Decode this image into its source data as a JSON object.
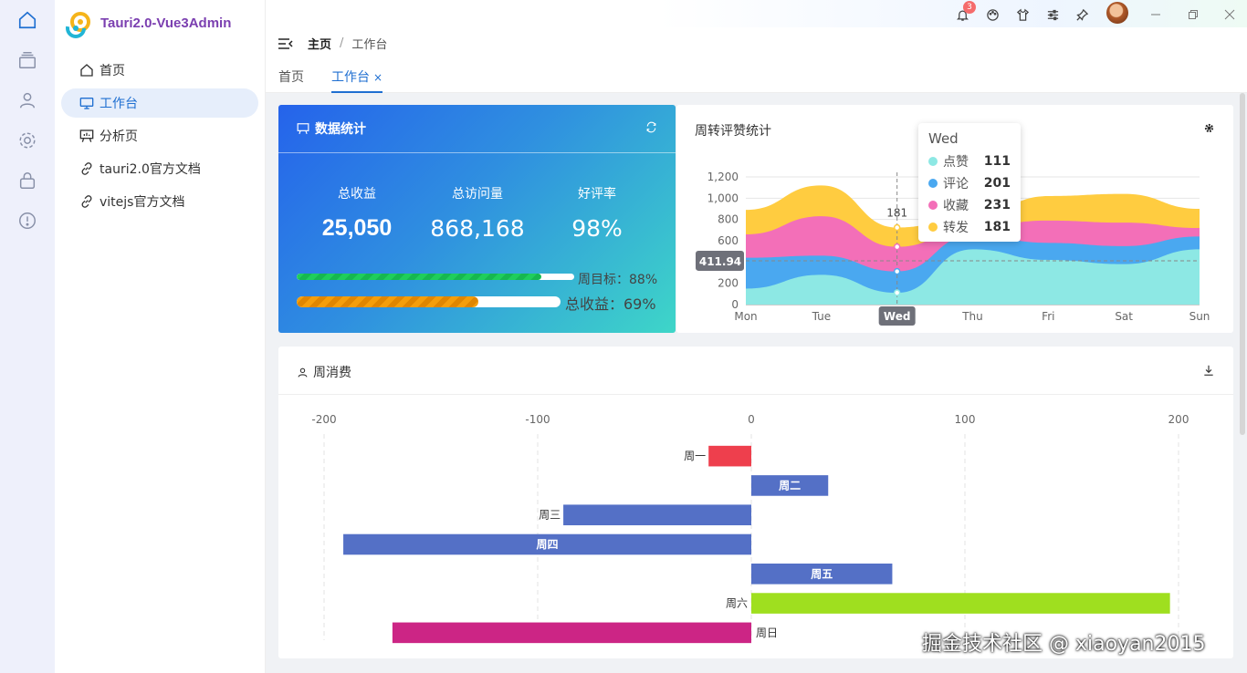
{
  "app": {
    "title": "Tauri2.0-Vue3Admin"
  },
  "rail": {
    "icons": [
      "home-icon",
      "layers-icon",
      "user-icon",
      "settings-icon",
      "lock-icon",
      "alert-icon"
    ]
  },
  "sidebar": {
    "items": [
      {
        "label": "首页",
        "icon": "home-icon",
        "active": false
      },
      {
        "label": "工作台",
        "icon": "monitor-icon",
        "active": true
      },
      {
        "label": "分析页",
        "icon": "chart-board-icon",
        "active": false
      },
      {
        "label": "tauri2.0官方文档",
        "icon": "link-icon",
        "active": false
      },
      {
        "label": "vitejs官方文档",
        "icon": "link-icon",
        "active": false
      }
    ]
  },
  "topbar": {
    "notification_count": "3",
    "icons": [
      "bell-icon",
      "palette-icon",
      "shirt-icon",
      "sliders-icon",
      "pin-icon",
      "avatar",
      "minimize-icon",
      "restore-icon",
      "close-icon"
    ]
  },
  "breadcrumb": {
    "root": "主页",
    "sep": "/",
    "current": "工作台"
  },
  "tabs": [
    {
      "label": "首页",
      "active": false
    },
    {
      "label": "工作台",
      "active": true,
      "close": "×"
    }
  ],
  "stats": {
    "title": "数据统计",
    "kpis": [
      {
        "label": "总收益",
        "value": "25,050"
      },
      {
        "label": "总访问量",
        "value": "868,168"
      },
      {
        "label": "好评率",
        "value": "98%"
      }
    ],
    "progress": [
      {
        "label": "周目标：88%",
        "value": 0.88,
        "color": "#22c55e"
      },
      {
        "label": "总收益：69%",
        "value": 0.69,
        "color": "#f59e0b"
      }
    ]
  },
  "chart_data": [
    {
      "type": "area",
      "title": "周转评赞统计",
      "stacked": true,
      "categories": [
        "Mon",
        "Tue",
        "Wed",
        "Thu",
        "Fri",
        "Sat",
        "Sun"
      ],
      "ylim": [
        0,
        1200
      ],
      "yticks": [
        "0",
        "200",
        "400",
        "600",
        "800",
        "1,000",
        "1,200"
      ],
      "series": [
        {
          "name": "点赞",
          "color": "#8de8e4",
          "values": [
            150,
            280,
            111,
            520,
            420,
            380,
            520
          ]
        },
        {
          "name": "评论",
          "color": "#4aa8f0",
          "values": [
            290,
            180,
            201,
            130,
            160,
            170,
            120
          ]
        },
        {
          "name": "收藏",
          "color": "#f36fb8",
          "values": [
            220,
            370,
            231,
            80,
            210,
            220,
            80
          ]
        },
        {
          "name": "转发",
          "color": "#ffcc40",
          "values": [
            230,
            290,
            181,
            100,
            230,
            270,
            180
          ]
        }
      ],
      "tooltip": {
        "category": "Wed",
        "label_on_chart": "181"
      },
      "crosshair_value": "411.94"
    },
    {
      "type": "bar",
      "orientation": "horizontal",
      "title": "周消费",
      "categories": [
        "周一",
        "周二",
        "周三",
        "周四",
        "周五",
        "周六",
        "周日"
      ],
      "values": [
        -20,
        36,
        -88,
        -191,
        66,
        196,
        -168
      ],
      "colors": [
        "#ee3f4d",
        "#5470c6",
        "#5470c6",
        "#5470c6",
        "#5470c6",
        "#9fdf1f",
        "#cc2585"
      ],
      "label_inside": [
        false,
        true,
        false,
        true,
        true,
        false,
        false
      ],
      "xlim": [
        -200,
        200
      ],
      "xticks": [
        "-200",
        "-100",
        "0",
        "100",
        "200"
      ]
    }
  ],
  "watermark": "掘金技术社区 @ xiaoyan2015"
}
